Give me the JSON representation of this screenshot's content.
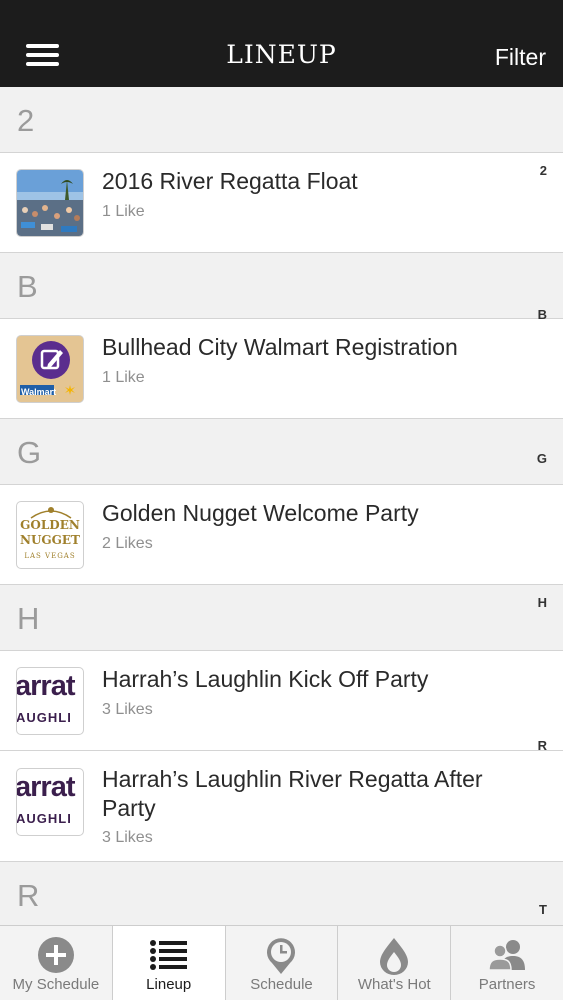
{
  "header": {
    "title": "LINEUP",
    "filter_label": "Filter"
  },
  "sections": [
    {
      "letter": "2",
      "items": [
        {
          "title": "2016 River Regatta Float",
          "likes": "1 Like",
          "thumb_icon": "river-regatta-photo"
        }
      ]
    },
    {
      "letter": "B",
      "items": [
        {
          "title": "Bullhead City Walmart Registration",
          "likes": "1 Like",
          "thumb_icon": "walmart-registration-logo",
          "thumb_text": "Walmart"
        }
      ]
    },
    {
      "letter": "G",
      "items": [
        {
          "title": "Golden Nugget Welcome Party",
          "likes": "2 Likes",
          "thumb_icon": "golden-nugget-logo",
          "thumb_text": [
            "GOLDEN",
            "NUGGET",
            "LAS VEGAS"
          ]
        }
      ]
    },
    {
      "letter": "H",
      "items": [
        {
          "title": "Harrah’s Laughlin Kick Off Party",
          "likes": "3 Likes",
          "thumb_icon": "harrahs-logo",
          "thumb_text": [
            "arrat",
            "AUGHLI"
          ]
        },
        {
          "title": "Harrah’s Laughlin River Regatta After Party",
          "likes": "3 Likes",
          "thumb_icon": "harrahs-logo",
          "thumb_text": [
            "arrat",
            "AUGHLI"
          ]
        }
      ]
    },
    {
      "letter": "R",
      "items": []
    }
  ],
  "index_letters": [
    "2",
    "B",
    "G",
    "H",
    "R",
    "T"
  ],
  "tabs": [
    {
      "label": "My Schedule",
      "icon": "plus-circle-icon",
      "active": false
    },
    {
      "label": "Lineup",
      "icon": "list-icon",
      "active": true
    },
    {
      "label": "Schedule",
      "icon": "clock-pin-icon",
      "active": false
    },
    {
      "label": "What's Hot",
      "icon": "flame-icon",
      "active": false
    },
    {
      "label": "Partners",
      "icon": "people-icon",
      "active": false
    }
  ],
  "colors": {
    "header_bg": "#1c1c1c",
    "section_bg": "#f1f1f1",
    "walmart_purple": "#5b2d8e",
    "nugget_gold": "#a0802c",
    "harrahs_purple": "#3b1f4d"
  }
}
